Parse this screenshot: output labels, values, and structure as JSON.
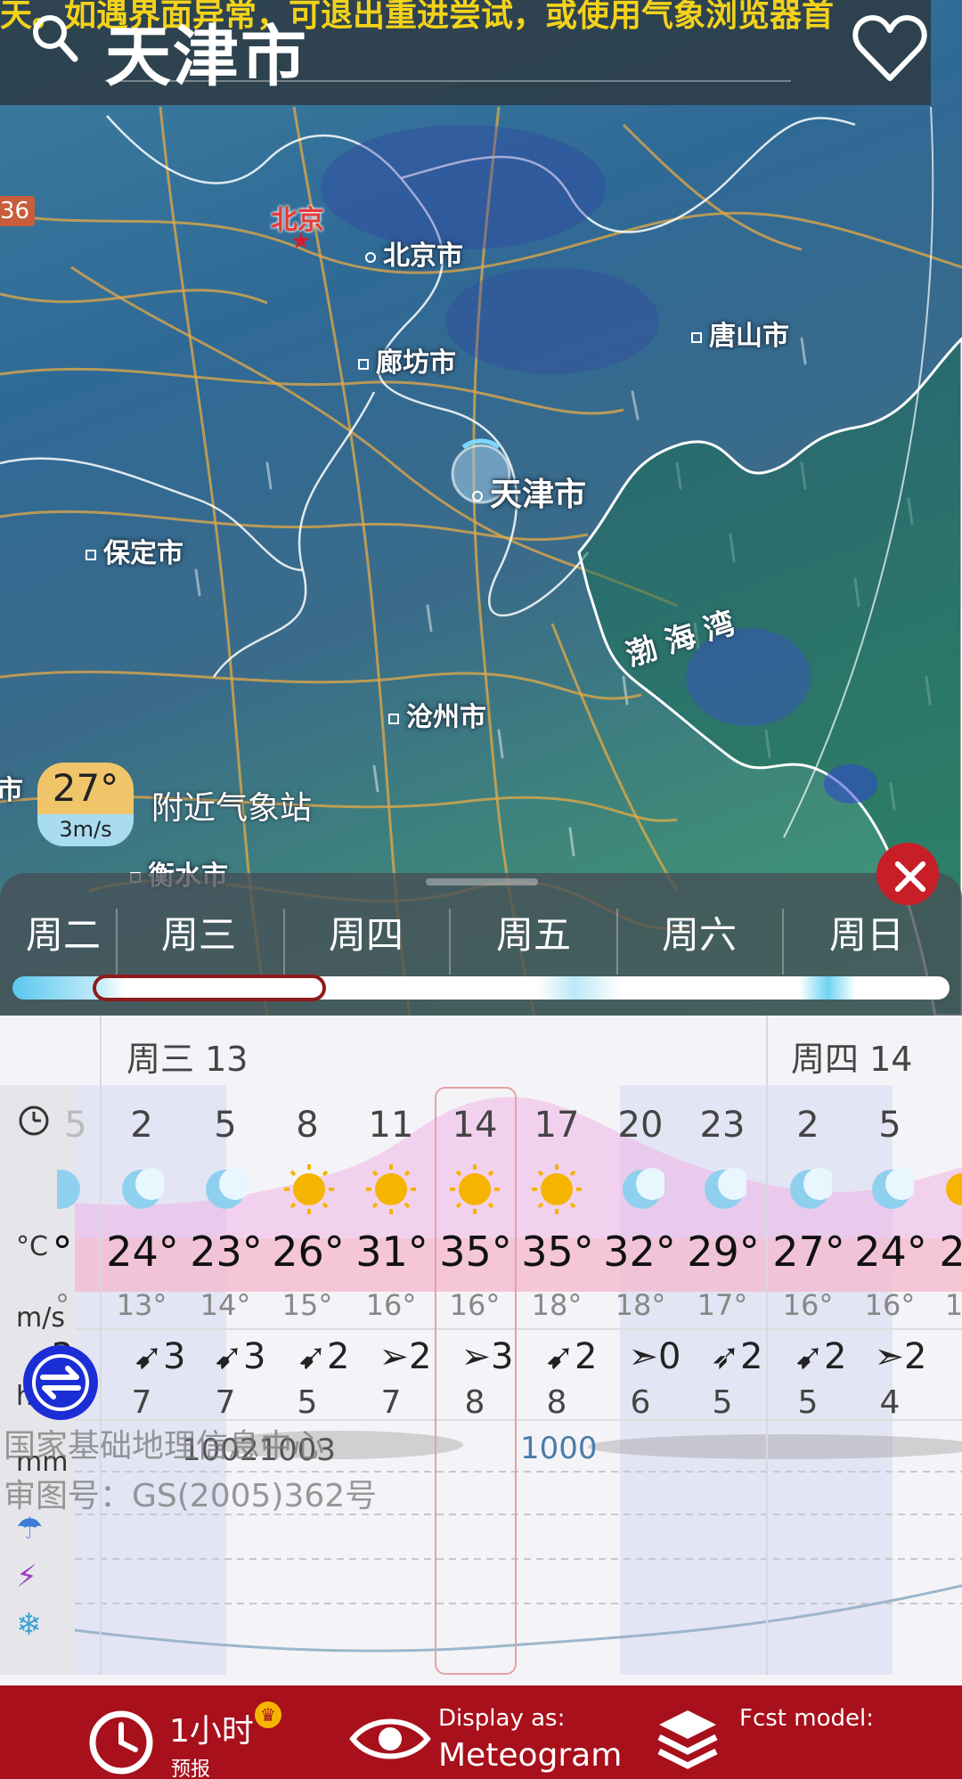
{
  "header": {
    "ticker": "天。如遇界面异常，可退出重进尝试，或使用气象浏览器首",
    "city_title": "天津市"
  },
  "map": {
    "capital": "北京",
    "cities": {
      "beijing": "北京市",
      "tangshan": "唐山市",
      "langfang": "廊坊市",
      "tianjin": "天津市",
      "baoding": "保定市",
      "cangzhou": "沧州市",
      "hengshui": "衡水市",
      "edge_left": "市",
      "edge_tag": "36"
    },
    "sea": "渤 海 湾"
  },
  "station": {
    "temp": "27°",
    "wind": "3m/s",
    "label": "附近气象站"
  },
  "day_tabs": [
    "周二",
    "周三",
    "周四",
    "周五",
    "周六",
    "周日"
  ],
  "meteogram": {
    "day_headers": [
      "周三 13",
      "周四 14"
    ],
    "units": {
      "clock": "clock-icon",
      "temp": "°C",
      "wind": "m/s",
      "pressure": "hPa",
      "precip": "mm"
    },
    "hours": [
      "5",
      "2",
      "5",
      "8",
      "11",
      "14",
      "17",
      "20",
      "23",
      "2",
      "5"
    ],
    "conditions": [
      "moon",
      "moon",
      "moon",
      "sun",
      "sun",
      "sun",
      "sun",
      "moon",
      "moon",
      "moon",
      "moon",
      "sun"
    ],
    "temps": [
      "°",
      "24°",
      "23°",
      "26°",
      "31°",
      "35°",
      "35°",
      "32°",
      "29°",
      "27°",
      "24°",
      "2"
    ],
    "dewpoints": [
      "°",
      "13°",
      "14°",
      "15°",
      "16°",
      "16°",
      "18°",
      "18°",
      "17°",
      "16°",
      "16°",
      "1"
    ],
    "wind_speed": [
      "3",
      "3",
      "3",
      "2",
      "2",
      "3",
      "2",
      "0",
      "2",
      "2",
      "2"
    ],
    "wind_gust": [
      "7",
      "7",
      "5",
      "7",
      "8",
      "8",
      "6",
      "5",
      "5",
      "4"
    ],
    "pressure_values": [
      "1002",
      "1003",
      "1000"
    ],
    "watermark": [
      "国家基础地理信息中心",
      "审图号：GS(2005)362号"
    ]
  },
  "bottom_bar": {
    "interval_value": "1小时",
    "interval_sub": "预报",
    "display_label": "Display as:",
    "display_value": "Meteogram",
    "model_label": "Fcst model:"
  },
  "colors": {
    "brand_red": "#a8101c",
    "ticker_yellow": "#f3d21a",
    "close_red": "#c81e28",
    "sun": "#f5b400",
    "moon": "#8fd0ef"
  }
}
